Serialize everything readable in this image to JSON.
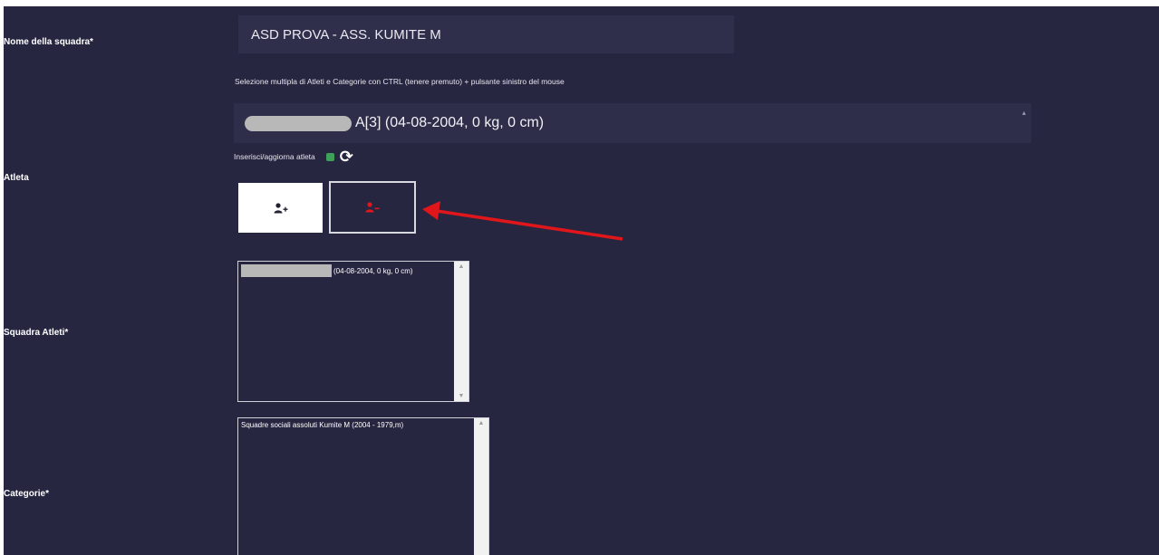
{
  "labels": {
    "team_name": "Nome della squadra*",
    "athlete": "Atleta",
    "team_athletes": "Squadra Atleti*",
    "categories": "Categorie*"
  },
  "team_name_value": "ASD PROVA - ASS. KUMITE M",
  "selection_hint": "Selezione multipla di Atleti e Categorie con CTRL (tenere premuto) + pulsante sinistro del mouse",
  "athlete_select": {
    "selected_text": "A[3] (04-08-2004, 0 kg, 0 cm)"
  },
  "insert_update_label": "Inserisci/aggiorna atleta",
  "icons": {
    "add_user": "add-user-icon",
    "remove_user": "remove-user-icon",
    "refresh": "refresh-icon",
    "leaf": "leaf-icon"
  },
  "team_athletes_list": {
    "items": [
      "(04-08-2004, 0 kg, 0 cm)"
    ]
  },
  "categories_list": {
    "items": [
      "Squadre sociali assoluti Kumite M (2004 - 1979,m)"
    ]
  },
  "colors": {
    "background": "#262641",
    "field": "#2f2f4b",
    "remove_icon": "#e0161b",
    "annotation_arrow": "#e0161b"
  }
}
